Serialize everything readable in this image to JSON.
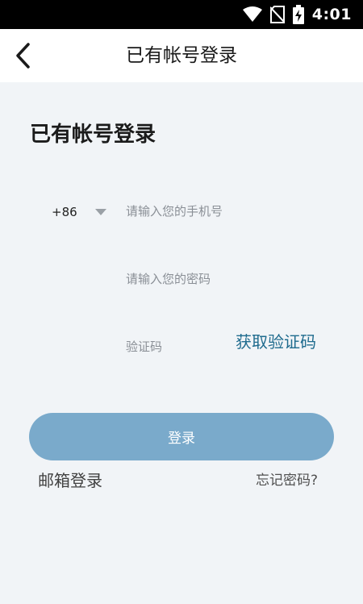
{
  "status_bar": {
    "time": "4:01",
    "icons": [
      "wifi-icon",
      "no-sim-icon",
      "battery-charging-icon"
    ]
  },
  "nav": {
    "title": "已有帐号登录",
    "back_icon": "chevron-left-icon"
  },
  "form": {
    "heading": "已有帐号登录",
    "country_code": "+86",
    "phone_placeholder": "请输入您的手机号",
    "password_placeholder": "请输入您的密码",
    "code_placeholder": "验证码",
    "get_code_label": "获取验证码",
    "login_label": "登录",
    "email_login_label": "邮箱登录",
    "forgot_label": "忘记密码?"
  },
  "colors": {
    "accent": "#1f6b8e",
    "button": "#7aaacb",
    "background": "#f1f4f7"
  }
}
